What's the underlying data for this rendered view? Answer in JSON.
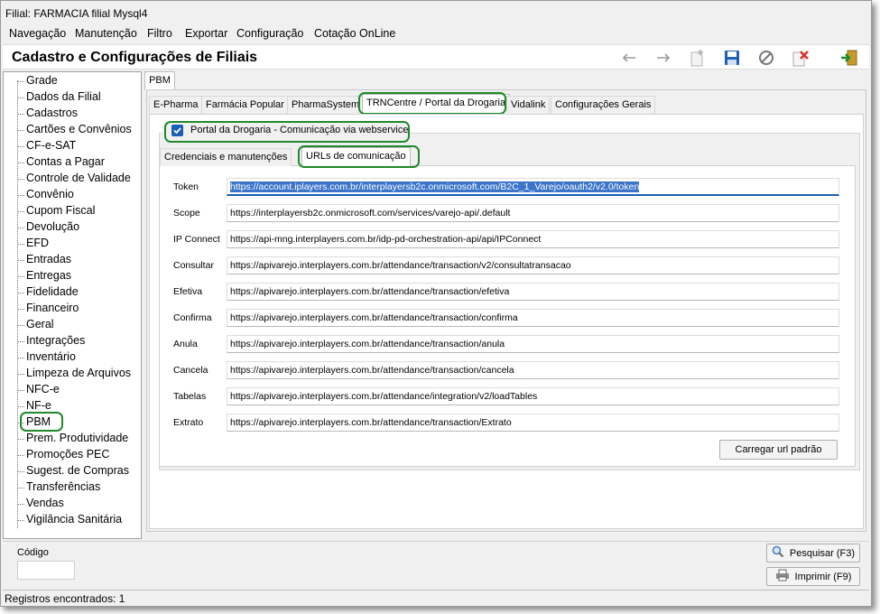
{
  "window": {
    "title": "Filial: FARMACIA filial Mysql4"
  },
  "menu": [
    {
      "label": "Navegação"
    },
    {
      "label": "Manutenção"
    },
    {
      "label": "Filtro"
    },
    {
      "label": "Exportar"
    },
    {
      "label": "Configuração"
    },
    {
      "label": "Cotação OnLine"
    }
  ],
  "header": {
    "title": "Cadastro e Configurações de Filiais"
  },
  "toolbar_icons": [
    "arrow-left-icon",
    "arrow-right-icon",
    "new-record-icon",
    "save-icon",
    "cancel-icon",
    "delete-icon",
    "exit-icon"
  ],
  "sidebar": {
    "selected": "PBM",
    "items": [
      "Grade",
      "Dados da Filial",
      "Cadastros",
      "Cartões e Convênios",
      "CF-e-SAT",
      "Contas a Pagar",
      "Controle de Validade",
      "Convênio",
      "Cupom Fiscal",
      "Devolução",
      "EFD",
      "Entradas",
      "Entregas",
      "Fidelidade",
      "Financeiro",
      "Geral",
      "Integrações",
      "Inventário",
      "Limpeza de Arquivos",
      "NFC-e",
      "NF-e",
      "PBM",
      "Prem. Produtividade",
      "Promoções PEC",
      "Sugest. de Compras",
      "Transferências",
      "Vendas",
      "Vigilância Sanitária"
    ]
  },
  "top_tab": {
    "label": "PBM"
  },
  "pbm_tabs": [
    "E-Pharma",
    "Farmácia Popular",
    "PharmaSystem",
    "TRNCentre / Portal da Drogaria",
    "Vidalink",
    "Configurações Gerais"
  ],
  "pbm_selected_tab": "TRNCentre / Portal da Drogaria",
  "checkbox": {
    "label": "Portal da Drogaria - Comunicação via webservice",
    "checked": true
  },
  "sub_tabs": [
    "Credenciais e manutenções",
    "URLs de comunicação"
  ],
  "sub_selected": "URLs de comunicação",
  "url_fields": [
    {
      "label": "Token",
      "value": "https://account.iplayers.com.br/interplayersb2c.onmicrosoft.com/B2C_1_Varejo/oauth2/v2.0/token"
    },
    {
      "label": "Scope",
      "value": "https://interplayersb2c.onmicrosoft.com/services/varejo-api/.default"
    },
    {
      "label": "IP Connect",
      "value": "https://api-mng.interplayers.com.br/idp-pd-orchestration-api/api/IPConnect"
    },
    {
      "label": "Consultar",
      "value": "https://apivarejo.interplayers.com.br/attendance/transaction/v2/consultatransacao"
    },
    {
      "label": "Efetiva",
      "value": "https://apivarejo.interplayers.com.br/attendance/transaction/efetiva"
    },
    {
      "label": "Confirma",
      "value": "https://apivarejo.interplayers.com.br/attendance/transaction/confirma"
    },
    {
      "label": "Anula",
      "value": "https://apivarejo.interplayers.com.br/attendance/transaction/anula"
    },
    {
      "label": "Cancela",
      "value": "https://apivarejo.interplayers.com.br/attendance/transaction/cancela"
    },
    {
      "label": "Tabelas",
      "value": "https://apivarejo.interplayers.com.br/attendance/integration/v2/loadTables"
    },
    {
      "label": "Extrato",
      "value": "https://apivarejo.interplayers.com.br/attendance/transaction/Extrato"
    }
  ],
  "load_default_button": "Carregar url padrão",
  "bottom": {
    "codigo_label": "Código",
    "codigo_value": "",
    "pesquisar": "Pesquisar (F3)",
    "imprimir": "Imprimir (F9)"
  },
  "status": {
    "text": "Registros encontrados: 1"
  },
  "colors": {
    "highlight": "#1f8a2a",
    "selection": "#3b74c9",
    "save_icon": "#1f5fb8",
    "delete_icon": "#d9342b"
  }
}
